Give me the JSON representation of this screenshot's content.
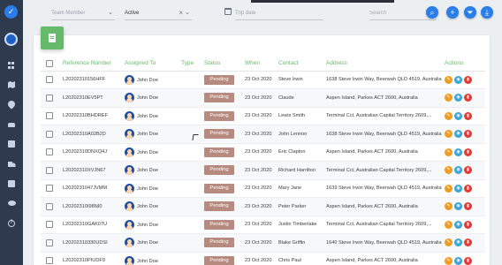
{
  "filters": {
    "team_member_placeholder": "Team Member",
    "status_value": "Active",
    "trip_date_placeholder": "Trip date",
    "search_placeholder": "Search"
  },
  "icons": {
    "logo": "logo-icon",
    "team_member_caret": "chevron-down-icon",
    "status_clear": "close-icon",
    "status_caret": "chevron-down-icon",
    "trip_date": "calendar-icon",
    "search_button": "search-icon",
    "add_button": "plus-icon",
    "filter_button": "filter-icon",
    "download_button": "download-icon",
    "card_badge": "document-icon",
    "row_edit": "pencil-icon",
    "row_view": "eye-icon",
    "row_delete": "trash-icon"
  },
  "sidebar": {
    "items": [
      {
        "icon": "dashboard-icon"
      },
      {
        "icon": "map-icon"
      },
      {
        "icon": "location-pin-icon"
      },
      {
        "icon": "car-icon"
      },
      {
        "icon": "calendar-icon"
      },
      {
        "icon": "truck-icon"
      },
      {
        "icon": "briefcase-icon"
      },
      {
        "icon": "users-icon"
      },
      {
        "icon": "help-icon"
      }
    ]
  },
  "colors": {
    "accent_green": "#66bb6a",
    "primary_blue": "#2b7de9",
    "pending_badge": "#b78a7f",
    "sidebar_bg": "#2e3a4e"
  },
  "table": {
    "headers": {
      "reference": "Reference Number",
      "assigned": "Assigned To",
      "type": "Type",
      "status": "Status",
      "when": "When",
      "contact": "Contact",
      "address": "Address",
      "actions": "Actions"
    },
    "rows": [
      {
        "ref": "L20202310156HFF",
        "assigned": "John Doe",
        "type": "",
        "status": "Pending",
        "when": "23 Oct 2020",
        "contact": "Steve Irwin",
        "address": "1638 Steve Irwin Way, Beerwah QLD 4519, Australia"
      },
      {
        "ref": "L20202310EV5PT",
        "assigned": "John Doe",
        "type": "",
        "status": "Pending",
        "when": "23 Oct 2020",
        "contact": "Claude",
        "address": "Aspen Island, Parkes ACT 2600, Australia"
      },
      {
        "ref": "L20202310BHDREF",
        "assigned": "John Doe",
        "type": "",
        "status": "Pending",
        "when": "23 Oct 2020",
        "contact": "Lewis Smith",
        "address": "Terminal Cct, Australian Capital Territory 2609,..."
      },
      {
        "ref": "L20202310A02B2D",
        "assigned": "John Doe",
        "type": "",
        "status": "Pending",
        "when": "23 Oct 2020",
        "contact": "John Lennon",
        "address": "1638 Steve Irwin Way, Beerwah QLD 4519, Australia"
      },
      {
        "ref": "L20202310DNXQ4J",
        "assigned": "John Doe",
        "type": "",
        "status": "Pending",
        "when": "23 Oct 2020",
        "contact": "Eric Clapton",
        "address": "Aspen Island, Parkes ACT 2600, Australia"
      },
      {
        "ref": "L20202310XVJN67",
        "assigned": "John Doe",
        "type": "",
        "status": "Pending",
        "when": "23 Oct 2020",
        "contact": "Richard Harrilton",
        "address": "Terminal Cct, Australian Capital Territory 2609,..."
      },
      {
        "ref": "L2020231047JVMM",
        "assigned": "John Doe",
        "type": "",
        "status": "Pending",
        "when": "23 Oct 2020",
        "contact": "Mary Jane",
        "address": "1639 Steve Irwin Way, Beerwah QLD 4519, Australia"
      },
      {
        "ref": "L20202310I98NI0",
        "assigned": "John Doe",
        "type": "",
        "status": "Pending",
        "when": "23 Oct 2020",
        "contact": "Peter Parker",
        "address": "Aspen Island, Parkes ACT 2600, Australia"
      },
      {
        "ref": "L20202310GAK07U",
        "assigned": "John Doe",
        "type": "",
        "status": "Pending",
        "when": "23 Oct 2020",
        "contact": "Justin Timberlake",
        "address": "Terminal Cct, Australian Capital Territory 2609,..."
      },
      {
        "ref": "L20202310330UDSI",
        "assigned": "John Doe",
        "type": "",
        "status": "Pending",
        "when": "23 Oct 2020",
        "contact": "Blake Griffin",
        "address": "1640 Steve Irwin Way, Beerwah QLD 4519, Australia"
      },
      {
        "ref": "L20202310PIUDF9",
        "assigned": "John Doe",
        "type": "",
        "status": "Pending",
        "when": "23 Oct 2020",
        "contact": "Chris Paul",
        "address": "Aspen Island, Parkes ACT 2600, Australia"
      }
    ]
  }
}
